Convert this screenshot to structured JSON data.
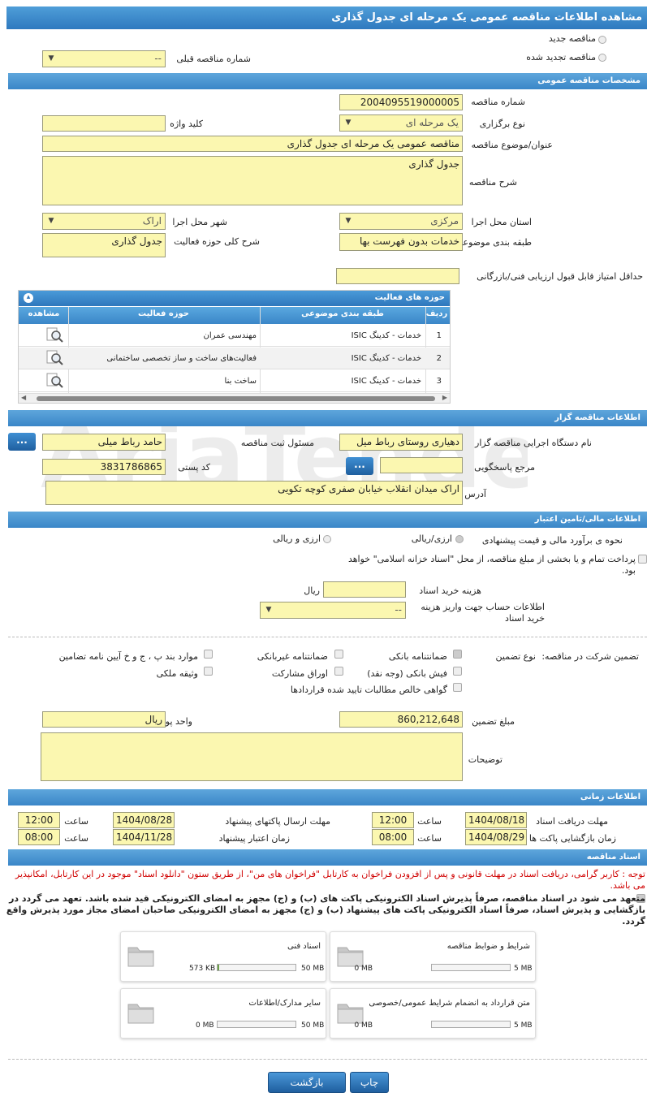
{
  "window": {
    "title": "مشاهده اطلاعات مناقصه عمومی یک مرحله ای جدول گذاری"
  },
  "top": {
    "new_tender": "مناقصه جدید",
    "renewed_tender": "مناقصه تجدید شده",
    "prev_tender_label": "شماره مناقصه قبلی",
    "prev_tender_value": "--"
  },
  "general": {
    "header": "مشخصات مناقصه عمومی",
    "number_label": "شماره مناقصه",
    "number_value": "2004095519000005",
    "type_label": "نوع برگزاری",
    "type_value": "یک مرحله ای",
    "keyword_label": "کلید واژه",
    "keyword_value": "",
    "title_label": "عنوان/موضوع مناقصه",
    "title_value": "مناقصه عمومی یک مرحله ای جدول گذاری",
    "desc_label": "شرح مناقصه",
    "desc_value": "جدول گذاری",
    "province_label": "استان محل اجرا",
    "province_value": "مرکزی",
    "city_label": "شهر محل اجرا",
    "city_value": "اراک",
    "category_label": "طبقه بندی موضوعی",
    "category_value": "خدمات بدون فهرست بها",
    "activity_desc_label": "شرح کلی حوزه فعالیت",
    "activity_desc_value": "جدول گذاری",
    "min_score_label": "حداقل امتیاز قابل قبول ارزیابی فنی/بازرگانی",
    "min_score_value": ""
  },
  "activity_grid": {
    "title": "حوزه های فعالیت",
    "columns": [
      "ردیف",
      "طبقه بندی موضوعی",
      "حوزه فعالیت",
      "مشاهده"
    ],
    "rows": [
      {
        "idx": "1",
        "category": "خدمات - کدینگ ISIC",
        "field": "مهندسی عمران"
      },
      {
        "idx": "2",
        "category": "خدمات - کدینگ ISIC",
        "field": "فعالیت‌های ساخت و ساز تخصصی ساختمانی"
      },
      {
        "idx": "3",
        "category": "خدمات - کدینگ ISIC",
        "field": "ساخت بنا"
      }
    ]
  },
  "organizer": {
    "header": "اطلاعات مناقصه گزار",
    "org_label": "نام دستگاه اجرایی مناقصه گزار",
    "org_value": "دهیاری روستای رباط میل",
    "resp_label": "مسئول ثبت مناقصه",
    "resp_value": "حامد رباط میلی",
    "ref_label": "مرجع پاسخگویی",
    "ref_value": "",
    "postal_label": "کد پستی",
    "postal_value": "3831786865",
    "address_label": "آدرس",
    "address_value": "اراک میدان انقلاب خیابان صفری کوچه تکویی",
    "btn": "..."
  },
  "finance": {
    "header": "اطلاعات مالی/تامین اعتبار",
    "estimate_label": "نحوه ی برآورد مالی و قیمت پیشنهادی",
    "opt1": "ارزی/ریالی",
    "opt2": "ارزی و ریالی",
    "treasury_text": "پرداخت تمام و یا بخشی از مبلغ مناقصه، از محل \"اسناد خزانه اسلامی\" خواهد بود.",
    "doc_fee_label": "هزینه خرید اسناد",
    "doc_fee_value": "",
    "doc_fee_unit": "ریال",
    "account_label": "اطلاعات حساب جهت واریز هزینه خرید اسناد",
    "account_value": "--"
  },
  "guarantee": {
    "label": "تضمین شرکت در مناقصه:",
    "type_label": "نوع تضمین",
    "opts": {
      "bank_guarantee": "ضمانتنامه بانکی",
      "non_bank": "ضمانتنامه غیربانکی",
      "clauses": "موارد بند پ ، ج و خ آیین نامه تضامین",
      "cash_receipt": "فیش بانکی (وجه نقد)",
      "bonds": "اوراق مشارکت",
      "property": "وثیقه ملکی",
      "receivables": "گواهی خالص مطالبات تایید شده قراردادها"
    },
    "amount_label": "مبلغ تضمین",
    "amount_value": "860,212,648",
    "currency_label": "واحد پول",
    "currency_value": "ریال",
    "notes_label": "توضیحات",
    "notes_value": ""
  },
  "timing": {
    "header": "اطلاعات زمانی",
    "receive_label": "مهلت دریافت اسناد",
    "receive_date": "1404/08/18",
    "receive_time": "12:00",
    "send_label": "مهلت ارسال پاکتهای پیشنهاد",
    "send_date": "1404/08/28",
    "send_time": "12:00",
    "open_label": "زمان بازگشایی پاکت ها",
    "open_date": "1404/08/29",
    "open_time": "08:00",
    "valid_label": "زمان اعتبار پیشنهاد",
    "valid_date": "1404/11/28",
    "valid_time": "08:00",
    "time_word": "ساعت"
  },
  "documents": {
    "header": "اسناد مناقصه",
    "notice": "توجه : کاربر گرامی، دریافت اسناد در مهلت قانونی و پس از افزودن فراخوان به کارتابل \"فراخوان های من\"، از طریق ستون \"دانلود اسناد\" موجود در این کارتابل، امکانپذیر می باشد.",
    "commit": "متعهد می شود در اسناد مناقصه، صرفاً پذیرش اسناد الکترونیکی پاکت های (ب) و (ج) مجهز به امضای الکترونیکی قید شده باشد. تعهد می گردد در بازگشایی و پذیرش اسناد، صرفاً اسناد الکترونیکی پاکت های پیشنهاد (ب) و (ج) مجهز به امضای الکترونیکی صاحبان امضای مجاز مورد پذیرش واقع گردد.",
    "items": [
      {
        "name": "شرایط و ضوابط مناقصه",
        "current": "0 MB",
        "max": "5 MB",
        "fill": 0
      },
      {
        "name": "اسناد فنی",
        "current": "573 KB",
        "max": "50 MB",
        "fill": 0.011
      },
      {
        "name": "متن قرارداد به انضمام شرایط عمومی/خصوصی",
        "current": "0 MB",
        "max": "5 MB",
        "fill": 0
      },
      {
        "name": "سایر مدارک/اطلاعات",
        "current": "0 MB",
        "max": "50 MB",
        "fill": 0
      }
    ]
  },
  "actions": {
    "print": "چاپ",
    "back": "بازگشت"
  },
  "watermark": "AriaTender.net",
  "colors": {
    "field_bg": "#fbf7b0",
    "header_blue": "#3a86c8",
    "notice_red": "#d00000"
  }
}
